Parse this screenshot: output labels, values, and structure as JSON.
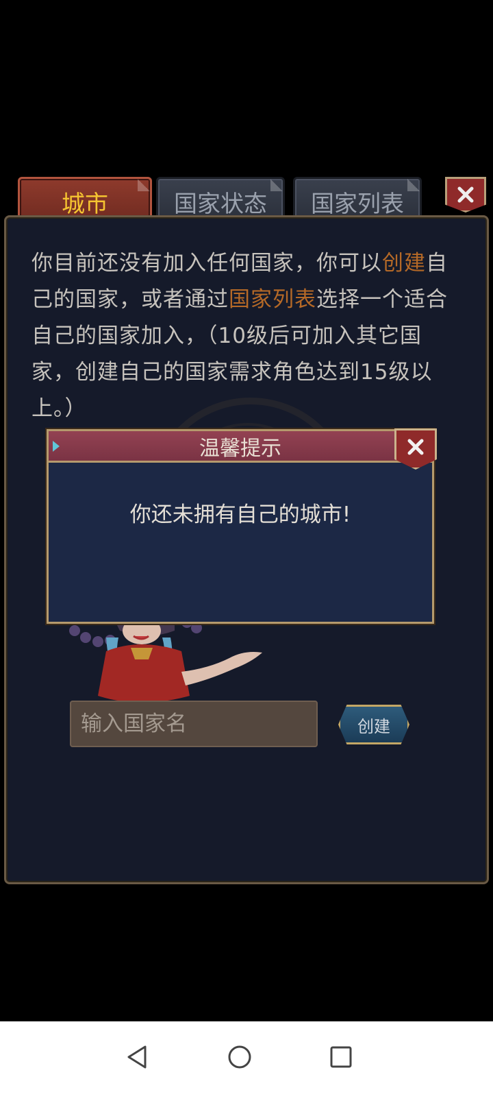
{
  "tabs": [
    {
      "label": "城市",
      "active": true
    },
    {
      "label": "国家状态",
      "active": false
    },
    {
      "label": "国家列表",
      "active": false
    }
  ],
  "description": {
    "part1": "你目前还没有加入任何国家，你可以",
    "link_create": "创建",
    "part2": "自己的国家，或者通过",
    "link_list": "国家列表",
    "part3": "选择一个适合自己的国家加入，（10级后可加入其它国家，创建自己的国家需求角色达到15级以上。）"
  },
  "modal": {
    "title": "温馨提示",
    "message": "你还未拥有自己的城市!"
  },
  "form": {
    "placeholder": "输入国家名",
    "create_label": "创建"
  },
  "colors": {
    "highlight": "#b56927",
    "tab_active_text": "#f5c431",
    "panel_bg": "#151a2a",
    "modal_title_bg": "#934252"
  },
  "icons": {
    "close": "close-icon",
    "nav_back": "triangle-back-icon",
    "nav_home": "circle-home-icon",
    "nav_recent": "square-recent-icon"
  }
}
